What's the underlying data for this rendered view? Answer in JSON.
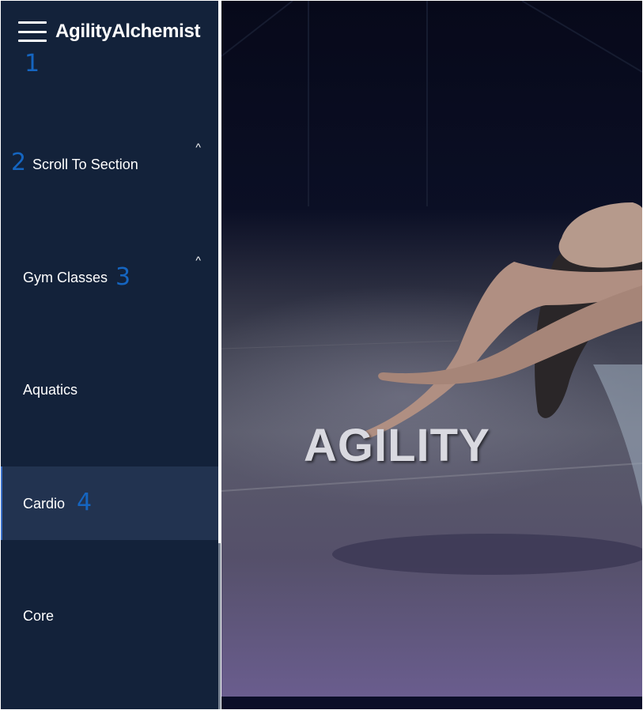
{
  "app": {
    "brand": "AgilityAlchemist"
  },
  "annotations": [
    "1",
    "2",
    "3",
    "4"
  ],
  "sidebar": {
    "items": [
      {
        "label": "Scroll To Section",
        "caret": "^"
      },
      {
        "label": "Gym Classes",
        "caret": "^"
      },
      {
        "label": "Aquatics"
      },
      {
        "label": "Cardio",
        "active": true
      },
      {
        "label": "Core"
      }
    ]
  },
  "hero": {
    "title": "AGILITY"
  },
  "colors": {
    "sidebar_bg": "#13223a",
    "active_bg": "#223350",
    "marker": "#1565c0"
  },
  "icons": [
    "menu-icon",
    "chevron-up-icon"
  ]
}
